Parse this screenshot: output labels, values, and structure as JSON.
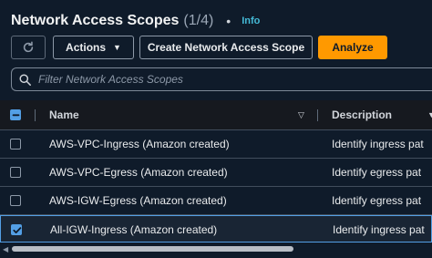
{
  "header": {
    "title": "Network Access Scopes",
    "count": "(1/4)",
    "separator": "•",
    "info": "Info"
  },
  "toolbar": {
    "actions_label": "Actions",
    "create_label": "Create Network Access Scope",
    "analyze_label": "Analyze"
  },
  "search": {
    "placeholder": "Filter Network Access Scopes",
    "value": ""
  },
  "table": {
    "columns": [
      "Name",
      "Description"
    ],
    "rows": [
      {
        "name": "AWS-VPC-Ingress (Amazon created)",
        "description": "Identify ingress pat",
        "selected": false
      },
      {
        "name": "AWS-VPC-Egress (Amazon created)",
        "description": "Identify egress pat",
        "selected": false
      },
      {
        "name": "AWS-IGW-Egress (Amazon created)",
        "description": "Identify egress pat",
        "selected": false
      },
      {
        "name": "All-IGW-Ingress (Amazon created)",
        "description": "Identify ingress pat",
        "selected": true
      }
    ]
  },
  "colors": {
    "background": "#0f1b2a",
    "accent": "#ff9900",
    "selection": "#539fe5",
    "link": "#44b9d6"
  }
}
